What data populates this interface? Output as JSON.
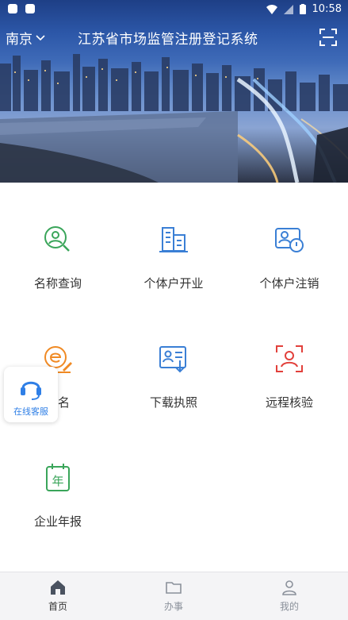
{
  "status_bar": {
    "time": "10:58"
  },
  "header": {
    "city": "南京",
    "title": "江苏省市场监管注册登记系统"
  },
  "services": [
    {
      "label": "名称查询",
      "icon": "search-user-icon"
    },
    {
      "label": "个体户开业",
      "icon": "building-icon"
    },
    {
      "label": "个体户注销",
      "icon": "cancel-card-icon"
    },
    {
      "label": "签名",
      "icon": "e-sign-icon"
    },
    {
      "label": "下载执照",
      "icon": "download-license-icon"
    },
    {
      "label": "远程核验",
      "icon": "face-verify-icon"
    },
    {
      "label": "企业年报",
      "icon": "annual-report-icon"
    }
  ],
  "floating_service": {
    "label": "在线客服",
    "icon": "headset-icon"
  },
  "tabbar": {
    "items": [
      {
        "label": "首页",
        "active": true
      },
      {
        "label": "办事",
        "active": false
      },
      {
        "label": "我的",
        "active": false
      }
    ]
  },
  "colors": {
    "green": "#3aa55a",
    "blue": "#3a7fd5",
    "orange": "#f08a24",
    "red": "#e2403b",
    "accent": "#2f7fe6"
  }
}
